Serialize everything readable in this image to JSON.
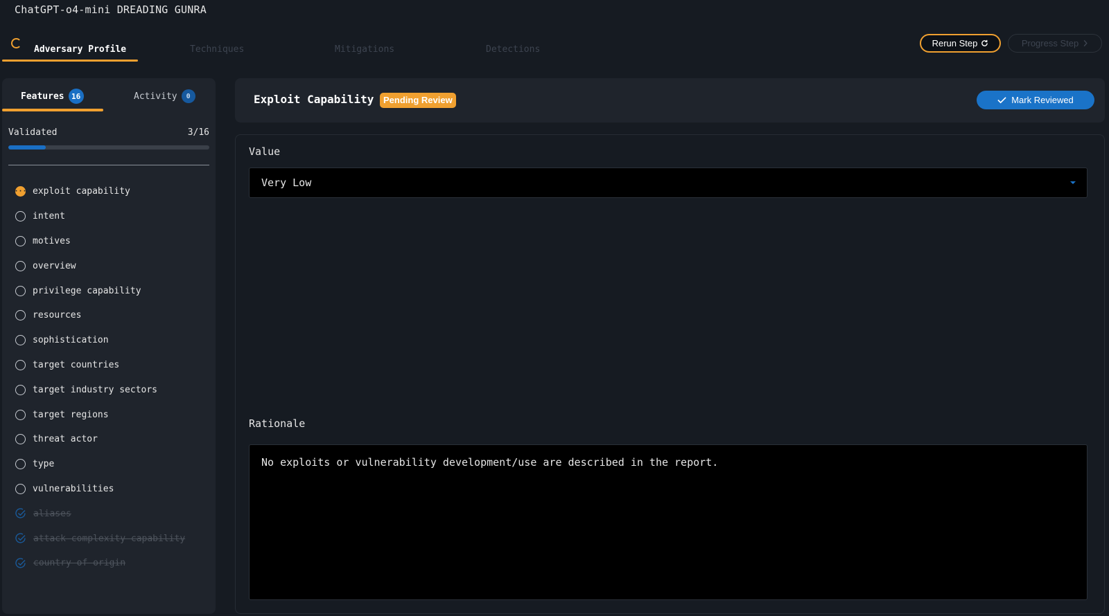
{
  "app": {
    "title": "ChatGPT-o4-mini DREADING GUNRA"
  },
  "tabs": [
    {
      "label": "Adversary Profile",
      "state": "active"
    },
    {
      "label": "Techniques",
      "state": "disabled"
    },
    {
      "label": "Mitigations",
      "state": "disabled"
    },
    {
      "label": "Detections",
      "state": "disabled"
    }
  ],
  "toolbar": {
    "rerun_label": "Rerun Step",
    "progress_label": "Progress Step"
  },
  "sidebar": {
    "tabs": [
      {
        "label": "Features",
        "count": "16",
        "active": true
      },
      {
        "label": "Activity",
        "count": "0",
        "active": false
      }
    ],
    "validated_label": "Validated",
    "validated_count": "3/16",
    "validated_fraction": 0.1875,
    "features": [
      {
        "label": "exploit capability",
        "status": "pending"
      },
      {
        "label": "intent",
        "status": "open"
      },
      {
        "label": "motives",
        "status": "open"
      },
      {
        "label": "overview",
        "status": "open"
      },
      {
        "label": "privilege capability",
        "status": "open"
      },
      {
        "label": "resources",
        "status": "open"
      },
      {
        "label": "sophistication",
        "status": "open"
      },
      {
        "label": "target countries",
        "status": "open"
      },
      {
        "label": "target industry sectors",
        "status": "open"
      },
      {
        "label": "target regions",
        "status": "open"
      },
      {
        "label": "threat actor",
        "status": "open"
      },
      {
        "label": "type",
        "status": "open"
      },
      {
        "label": "vulnerabilities",
        "status": "open"
      },
      {
        "label": "aliases",
        "status": "validated"
      },
      {
        "label": "attack complexity capability",
        "status": "validated"
      },
      {
        "label": "country of origin",
        "status": "validated"
      }
    ]
  },
  "detail": {
    "title": "Exploit Capability",
    "status_badge": "Pending Review",
    "mark_reviewed_label": "Mark Reviewed",
    "value_label": "Value",
    "value_selected": "Very Low",
    "rationale_label": "Rationale",
    "rationale_text": "No exploits or vulnerability development/use are described in the report."
  },
  "colors": {
    "accent": "#f0a030",
    "primary": "#1a73c8",
    "background": "#161b22",
    "panel": "#1f242c"
  }
}
